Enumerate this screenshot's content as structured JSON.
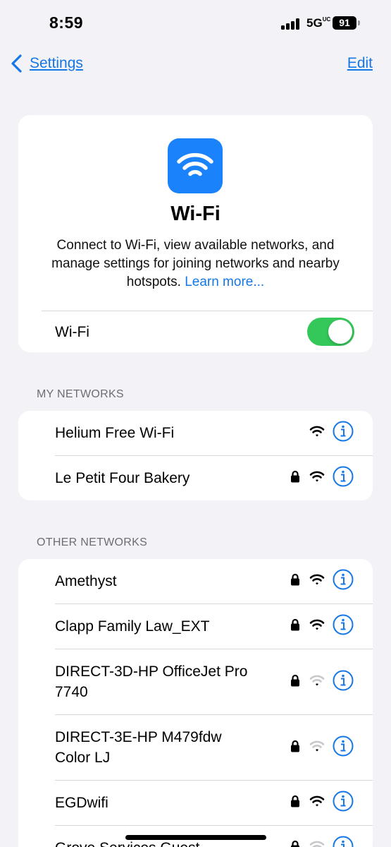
{
  "status_bar": {
    "time": "8:59",
    "network": "5G",
    "network_suffix": "UC",
    "battery": "91"
  },
  "nav": {
    "back_label": "Settings",
    "edit_label": "Edit"
  },
  "hero": {
    "icon": "wifi-icon",
    "title": "Wi-Fi",
    "description": "Connect to Wi-Fi, view available networks, and manage settings for joining networks and nearby hotspots.",
    "learn_more": "Learn more...",
    "toggle_label": "Wi-Fi",
    "toggle_on": true,
    "toggle_color": "#34c759"
  },
  "my_networks": {
    "header": "MY NETWORKS",
    "items": [
      {
        "name": "Helium Free Wi-Fi",
        "locked": false,
        "signal": "strong"
      },
      {
        "name": "Le Petit Four Bakery",
        "locked": true,
        "signal": "strong"
      }
    ]
  },
  "other_networks": {
    "header": "OTHER NETWORKS",
    "items": [
      {
        "name": "Amethyst",
        "locked": true,
        "signal": "strong"
      },
      {
        "name": "Clapp Family Law_EXT",
        "locked": true,
        "signal": "strong"
      },
      {
        "name": "DIRECT-3D-HP OfficeJet Pro 7740",
        "locked": true,
        "signal": "weak"
      },
      {
        "name": "DIRECT-3E-HP M479fdw Color LJ",
        "locked": true,
        "signal": "weak"
      },
      {
        "name": "EGDwifi",
        "locked": true,
        "signal": "strong"
      },
      {
        "name": "Grove Services Guest",
        "locked": true,
        "signal": "weak"
      }
    ]
  },
  "colors": {
    "accent": "#1677e6",
    "background": "#f2f2f7",
    "icon_bg": "#1a82fb"
  }
}
